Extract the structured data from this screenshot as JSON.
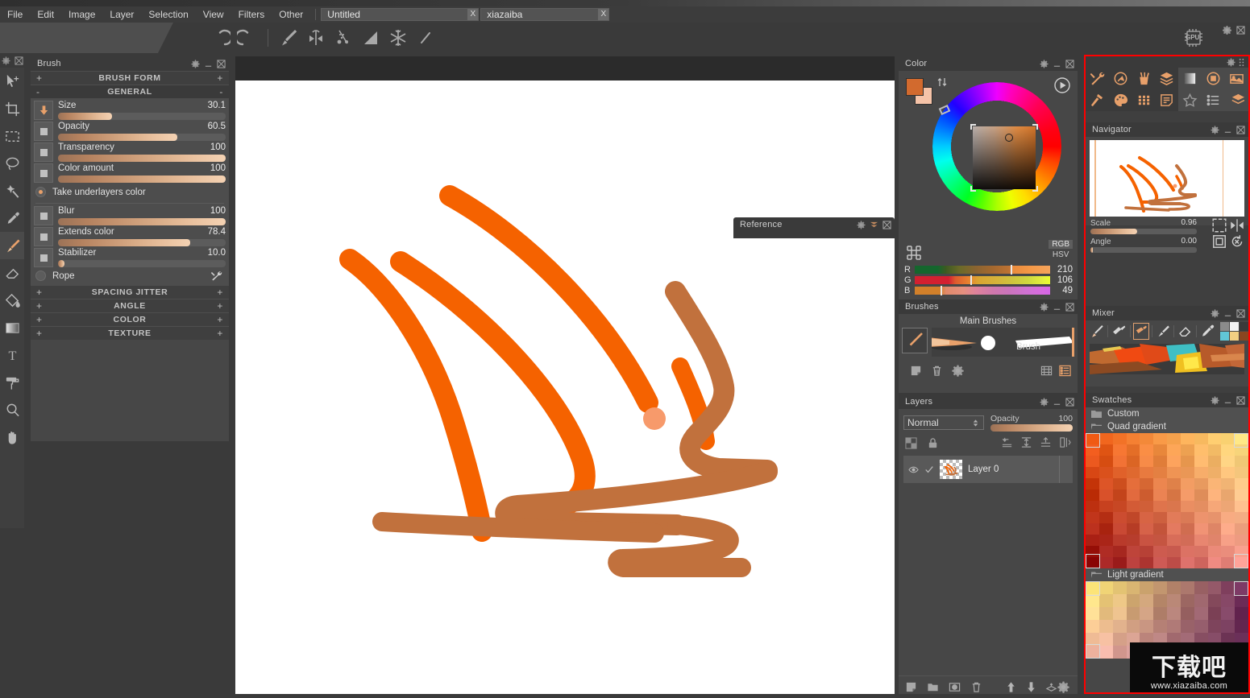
{
  "app": {
    "title_bar_text": "",
    "menu": [
      "File",
      "Edit",
      "Image",
      "Layer",
      "Selection",
      "View",
      "Filters",
      "Other"
    ],
    "documents": [
      {
        "name": "Untitled",
        "close": "X"
      },
      {
        "name": "xiazaiba",
        "close": "X"
      }
    ],
    "window_controls": [
      "lock",
      "minimize",
      "maximize",
      "close"
    ],
    "gpu_badge": "GPU"
  },
  "toolbar": {
    "icons": [
      "undo-icon",
      "redo-icon",
      "brush-icon",
      "symmetry-icon",
      "scatter-icon",
      "ruler-icon",
      "snowflake-icon",
      "line-icon"
    ]
  },
  "left_tools": [
    {
      "name": "move-tool",
      "selected": false
    },
    {
      "name": "crop-tool",
      "selected": false
    },
    {
      "name": "rect-select-tool",
      "selected": false
    },
    {
      "name": "lasso-tool",
      "selected": false
    },
    {
      "name": "magic-wand-tool",
      "selected": false
    },
    {
      "name": "eyedropper-tool",
      "selected": false
    },
    {
      "name": "paint-brush-tool",
      "selected": true
    },
    {
      "name": "eraser-tool",
      "selected": false
    },
    {
      "name": "fill-bucket-tool",
      "selected": false
    },
    {
      "name": "gradient-tool",
      "selected": false
    },
    {
      "name": "text-tool",
      "selected": false
    },
    {
      "name": "roller-tool",
      "selected": false
    },
    {
      "name": "zoom-tool",
      "selected": false
    },
    {
      "name": "hand-tool",
      "selected": false
    }
  ],
  "brush_panel": {
    "title": "Brush",
    "sections": [
      {
        "label": "BRUSH FORM",
        "left": "+",
        "right": "+",
        "expanded": false
      },
      {
        "label": "GENERAL",
        "left": "-",
        "right": "-",
        "expanded": true
      }
    ],
    "sliders": [
      {
        "label": "Size",
        "value": "30.1",
        "pct": 32,
        "icon": "arrow-down-icon"
      },
      {
        "label": "Opacity",
        "value": "60.5",
        "pct": 70,
        "icon": "square-icon"
      },
      {
        "label": "Transparency",
        "value": "100",
        "pct": 100,
        "icon": "square-icon"
      },
      {
        "label": "Color amount",
        "value": "100",
        "pct": 100,
        "icon": "square-icon"
      }
    ],
    "take_underlayers": {
      "label": "Take underlayers color",
      "checked": true
    },
    "sliders2": [
      {
        "label": "Blur",
        "value": "100",
        "pct": 100,
        "icon": "square-icon"
      },
      {
        "label": "Extends color",
        "value": "78.4",
        "pct": 78,
        "icon": "square-icon"
      },
      {
        "label": "Stabilizer",
        "value": "10.0",
        "pct": 4,
        "icon": "square-icon"
      }
    ],
    "rope": {
      "label": "Rope",
      "checked": false
    },
    "collapsed": [
      {
        "label": "SPACING JITTER",
        "left": "+",
        "right": "+"
      },
      {
        "label": "ANGLE",
        "left": "+",
        "right": "+"
      },
      {
        "label": "COLOR",
        "left": "+",
        "right": "+"
      },
      {
        "label": "TEXTURE",
        "left": "+",
        "right": "+"
      }
    ]
  },
  "reference_panel": {
    "title": "Reference"
  },
  "color_panel": {
    "title": "Color",
    "mode_rgb": "RGB",
    "mode_hsv": "HSV",
    "channels": [
      {
        "label": "R",
        "value": "210"
      },
      {
        "label": "G",
        "value": "106"
      },
      {
        "label": "B",
        "value": "49"
      }
    ],
    "foreground": "#d26a2e",
    "background": "#f5c3a8"
  },
  "brushes_panel": {
    "title": "Brushes",
    "group_label": "Main Brushes",
    "brush_name": "Brush"
  },
  "layers_panel": {
    "title": "Layers",
    "blend_mode": "Normal",
    "opacity_label": "Opacity",
    "opacity_value": "100",
    "layers": [
      {
        "name": "Layer 0",
        "visible": true,
        "checked": true
      }
    ]
  },
  "right_dock": {
    "icon_grid": [
      "tools-icon",
      "compass-icon",
      "pencil-cup-icon",
      "layers-icon",
      "gradient-icon",
      "color-circle-icon",
      "image-icon",
      "hammer-icon",
      "palette-icon",
      "swatch-grid-icon",
      "note-icon",
      "star-icon",
      "list-icon",
      "stack-icon"
    ],
    "navigator": {
      "title": "Navigator",
      "scale_label": "Scale",
      "scale_value": "0.96",
      "angle_label": "Angle",
      "angle_value": "0.00",
      "buttons": [
        "fit-icon",
        "mirror-icon",
        "actual-size-icon",
        "reset-rotation-icon"
      ]
    },
    "mixer": {
      "title": "Mixer",
      "tools": [
        "brush-icon",
        "palette-knife-icon",
        "wide-brush-icon",
        "blender-icon",
        "eraser-icon",
        "eyedropper-icon"
      ],
      "selected_tool_index": 2,
      "swatches": [
        "#8b8b8b",
        "#f2f2f2",
        "#3a3a3a",
        "#61c6d6",
        "#f2cf82",
        "#8a4620"
      ]
    },
    "swatches": {
      "title": "Swatches",
      "groups": [
        {
          "name": "Custom",
          "type": "folder"
        },
        {
          "name": "Quad gradient",
          "type": "gradient"
        },
        {
          "name": "Light gradient",
          "type": "gradient"
        }
      ]
    }
  },
  "watermark": {
    "text": "下载吧",
    "url": "www.xiazaiba.com"
  },
  "colors": {
    "accent": "#e8a06a",
    "panel_bg": "#474747",
    "panel_header": "#3a3a3a",
    "highlight_red": "#ff0000",
    "art_orange": "#f56200",
    "art_brown": "#c1713d"
  }
}
